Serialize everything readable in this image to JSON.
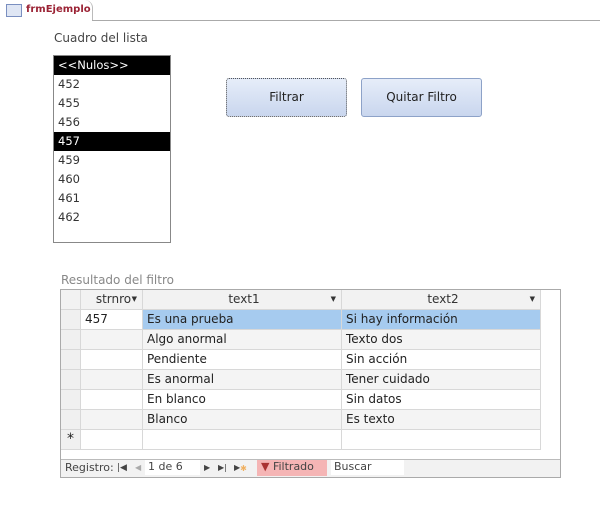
{
  "tab": {
    "title": "frmEjemplo"
  },
  "listbox": {
    "label": "Cuadro del lista",
    "items": [
      "<<Nulos>>",
      "452",
      "455",
      "456",
      "457",
      "459",
      "460",
      "461",
      "462"
    ],
    "selected": [
      "<<Nulos>>",
      "457"
    ]
  },
  "buttons": {
    "filter": "Filtrar",
    "clear_filter": "Quitar Filtro"
  },
  "grid": {
    "label": "Resultado del filtro",
    "columns": [
      "strnro",
      "text1",
      "text2"
    ],
    "rows": [
      [
        "457",
        "Es una prueba",
        "Si hay información"
      ],
      [
        "",
        "Algo anormal",
        "Texto dos"
      ],
      [
        "",
        "Pendiente",
        "Sin acción"
      ],
      [
        "",
        "Es anormal",
        "Tener cuidado"
      ],
      [
        "",
        "En blanco",
        "Sin datos"
      ],
      [
        "",
        "Blanco",
        "Es texto"
      ]
    ],
    "new_row_marker": "*"
  },
  "nav": {
    "label": "Registro:",
    "position": "1 de 6",
    "filter_status": "Filtrado",
    "search_placeholder": "Buscar"
  }
}
